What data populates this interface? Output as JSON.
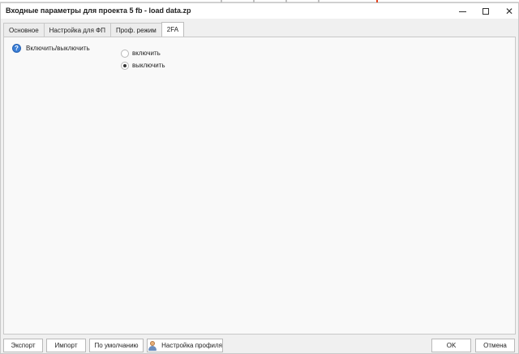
{
  "window": {
    "title": "Входные параметры для проекта 5 fb - load data.zp",
    "controls": {
      "minimize_icon": "minimize-icon",
      "maximize_icon": "maximize-icon",
      "close_glyph": "✕"
    }
  },
  "tabs": [
    {
      "label": "Основное",
      "active": false
    },
    {
      "label": "Настройка для ФП",
      "active": false
    },
    {
      "label": "Проф. режим",
      "active": false
    },
    {
      "label": "2FA",
      "active": true
    }
  ],
  "setting": {
    "help_glyph": "?",
    "label": "Включить/выключить",
    "options": [
      {
        "label": "включить",
        "selected": false
      },
      {
        "label": "выключить",
        "selected": true
      }
    ]
  },
  "footer": {
    "export_label": "Экспорт",
    "import_label": "Импорт",
    "default_label": "По умолчанию",
    "profile_label": "Настройка профиля",
    "ok_label": "OK",
    "cancel_label": "Отмена"
  }
}
